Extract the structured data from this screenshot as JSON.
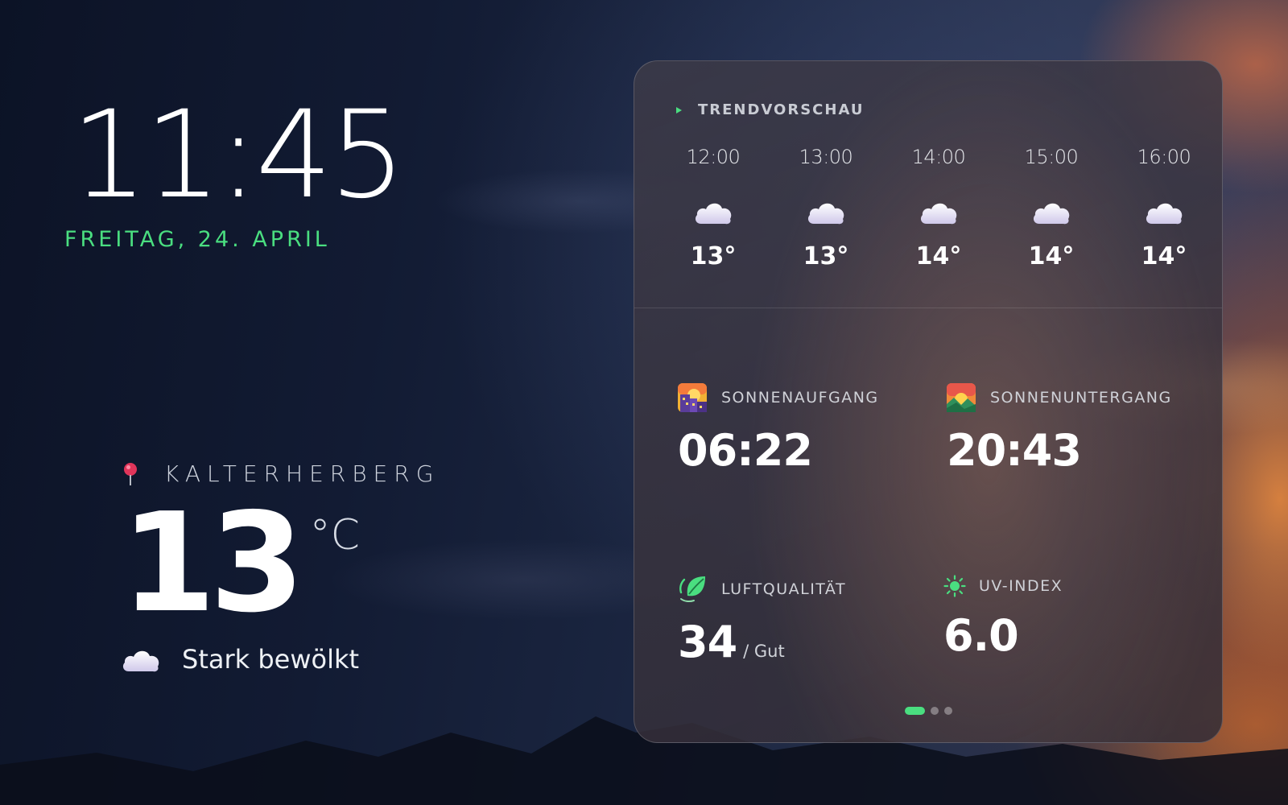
{
  "clock": {
    "time": "11:45",
    "date": "FREITAG, 24. APRIL"
  },
  "location": {
    "name": "KALTERHERBERG",
    "icon": "map-pin-icon"
  },
  "current": {
    "temperature": "13",
    "unit": "°C",
    "condition": "Stark bewölkt",
    "icon": "cloud-icon"
  },
  "forecast": {
    "title": "TRENDVORSCHAU",
    "hours": [
      {
        "time": "12:00",
        "temp": "13°",
        "icon": "cloud-icon"
      },
      {
        "time": "13:00",
        "temp": "13°",
        "icon": "cloud-icon"
      },
      {
        "time": "14:00",
        "temp": "14°",
        "icon": "cloud-icon"
      },
      {
        "time": "15:00",
        "temp": "14°",
        "icon": "cloud-icon"
      },
      {
        "time": "16:00",
        "temp": "14°",
        "icon": "cloud-icon"
      }
    ]
  },
  "details": {
    "sunrise": {
      "label": "SONNENAUFGANG",
      "value": "06:22",
      "icon": "sunrise-icon"
    },
    "sunset": {
      "label": "SONNENUNTERGANG",
      "value": "20:43",
      "icon": "sunset-icon"
    },
    "air_quality": {
      "label": "LUFTQUALITÄT",
      "value": "34",
      "sub": "/ Gut",
      "icon": "leaf-icon"
    },
    "uv_index": {
      "label": "UV-INDEX",
      "value": "6.0",
      "icon": "sun-icon"
    }
  },
  "pager": {
    "pages": 3,
    "active": 1
  },
  "colors": {
    "accent": "#4ade80"
  }
}
